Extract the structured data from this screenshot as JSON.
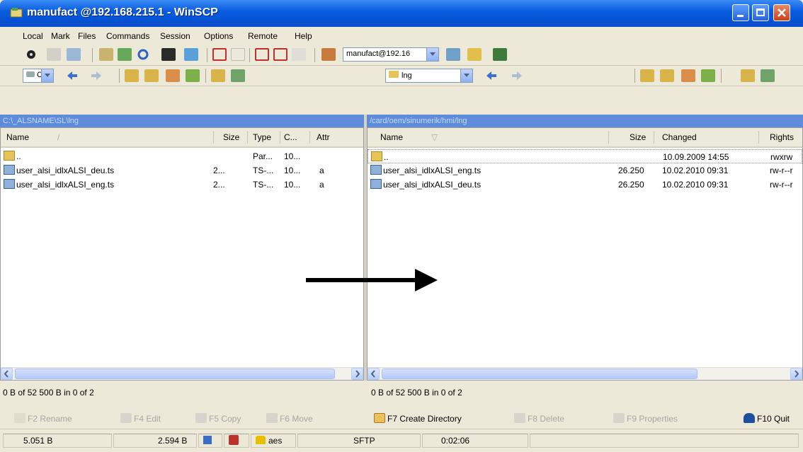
{
  "window": {
    "title": "manufact @192.168.215.1 - WinSCP"
  },
  "menu": [
    "Local",
    "Mark",
    "Files",
    "Commands",
    "Session",
    "Options",
    "Remote",
    "Help"
  ],
  "toolbar": {
    "session_combo": "manufact@192.16"
  },
  "left_panel": {
    "drive_combo": "C",
    "path": "C:\\_ALSNAME\\SL\\lng",
    "columns": [
      "Name",
      "Size",
      "Type",
      "C...",
      "Attr"
    ],
    "rows": [
      {
        "name": "..",
        "size": "",
        "type": "Par...",
        "changed": "10...",
        "attr": ""
      },
      {
        "name": "user_alsi_idlxALSI_deu.ts",
        "size": "2...",
        "type": "TS-...",
        "changed": "10...",
        "attr": "a"
      },
      {
        "name": "user_alsi_idlxALSI_eng.ts",
        "size": "2...",
        "type": "TS-...",
        "changed": "10...",
        "attr": "a"
      }
    ],
    "status": "0 B of 52 500 B in 0 of 2"
  },
  "right_panel": {
    "dir_combo": "lng",
    "path": "/card/oem/sinumerik/hmi/lng",
    "columns": [
      "Name",
      "Size",
      "Changed",
      "Rights"
    ],
    "rows": [
      {
        "name": "..",
        "size": "",
        "changed": "10.09.2009 14:55",
        "rights": "rwxrw"
      },
      {
        "name": "user_alsi_idlxALSI_eng.ts",
        "size": "26.250",
        "changed": "10.02.2010 09:31",
        "rights": "rw-r--r"
      },
      {
        "name": "user_alsi_idlxALSI_deu.ts",
        "size": "26.250",
        "changed": "10.02.2010 09:31",
        "rights": "rw-r--r"
      }
    ],
    "status": "0 B of 52 500 B in 0 of 2"
  },
  "fkeys": [
    {
      "label": "F2 Rename",
      "enabled": false
    },
    {
      "label": "F4 Edit",
      "enabled": false
    },
    {
      "label": "F5 Copy",
      "enabled": false
    },
    {
      "label": "F6 Move",
      "enabled": false
    },
    {
      "label": "F7 Create Directory",
      "enabled": true
    },
    {
      "label": "F8 Delete",
      "enabled": false
    },
    {
      "label": "F9 Properties",
      "enabled": false
    },
    {
      "label": "F10 Quit",
      "enabled": true
    }
  ],
  "bottom_status": {
    "bytes_sent": "5.051 B",
    "bytes_received": "2.594 B",
    "cipher": "aes",
    "protocol": "SFTP",
    "duration": "0:02:06"
  },
  "colors": {
    "title_bar": "#0554D8",
    "panel_path_bar": "#5E8CDB",
    "window_bg": "#ECE9D8"
  }
}
